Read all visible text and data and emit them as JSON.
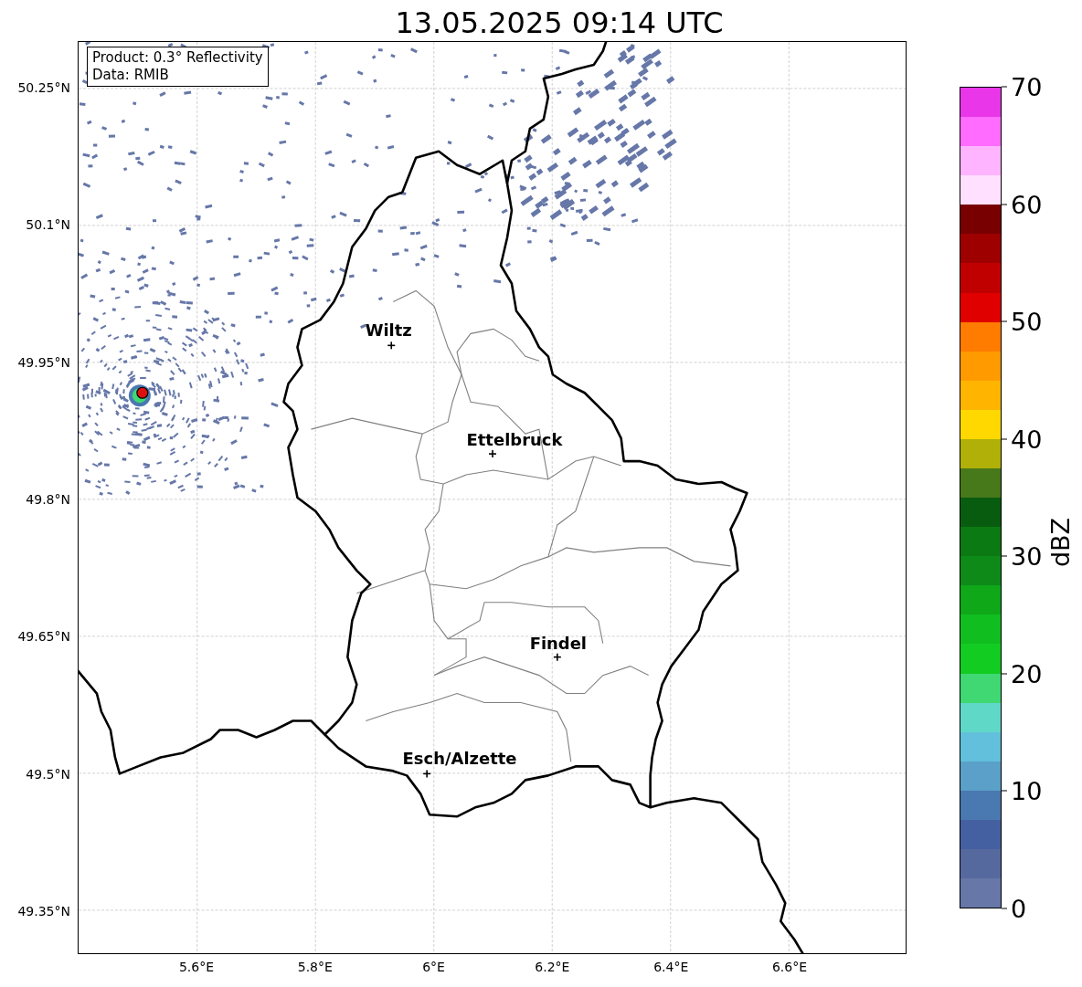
{
  "title": "13.05.2025 09:14 UTC",
  "info_box": {
    "lines": [
      "Product: 0.3° Reflectivity",
      "Data: RMIB"
    ]
  },
  "map": {
    "cities": [
      {
        "name": "Wiltz"
      },
      {
        "name": "Ettelbruck"
      },
      {
        "name": "Findel"
      },
      {
        "name": "Esch/Alzette"
      }
    ],
    "lat_ticks": [
      "50.25°N",
      "50.1°N",
      "49.95°N",
      "49.8°N",
      "49.65°N",
      "49.5°N",
      "49.35°N"
    ],
    "lon_ticks": [
      "5.6°E",
      "5.8°E",
      "6°E",
      "6.2°E",
      "6.4°E",
      "6.6°E"
    ]
  },
  "colorbar": {
    "label": "dBZ",
    "ticks": [
      "70",
      "60",
      "50",
      "40",
      "30",
      "20",
      "10",
      "0"
    ],
    "bins": [
      {
        "color": "#e836e8"
      },
      {
        "color": "#ff6cff"
      },
      {
        "color": "#ffb4ff"
      },
      {
        "color": "#ffe0ff"
      },
      {
        "color": "#780000"
      },
      {
        "color": "#9e0000"
      },
      {
        "color": "#c00000"
      },
      {
        "color": "#e00000"
      },
      {
        "color": "#ff7c00"
      },
      {
        "color": "#ff9a00"
      },
      {
        "color": "#ffb500"
      },
      {
        "color": "#ffd800"
      },
      {
        "color": "#b0b008"
      },
      {
        "color": "#47781a"
      },
      {
        "color": "#085c10"
      },
      {
        "color": "#0b7a12"
      },
      {
        "color": "#0e8a18"
      },
      {
        "color": "#0ea818"
      },
      {
        "color": "#10be20"
      },
      {
        "color": "#12cc22"
      },
      {
        "color": "#3fd873"
      },
      {
        "color": "#60d8c8"
      },
      {
        "color": "#62c0dc"
      },
      {
        "color": "#5aa0c8"
      },
      {
        "color": "#4a78b0"
      },
      {
        "color": "#4560a0"
      },
      {
        "color": "#56699f"
      },
      {
        "color": "#6677a8"
      }
    ]
  }
}
